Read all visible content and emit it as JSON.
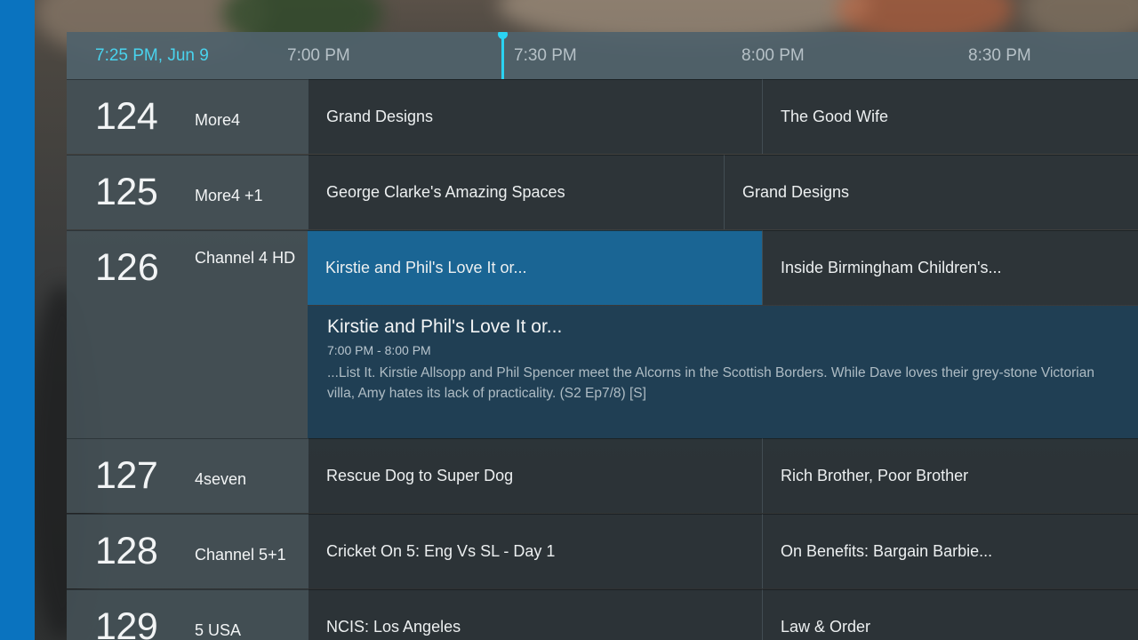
{
  "timebar": {
    "current": "7:25 PM, Jun 9",
    "slots": [
      "7:00 PM",
      "7:30 PM",
      "8:00 PM",
      "8:30 PM"
    ]
  },
  "channels": [
    {
      "number": "124",
      "name": "More4",
      "programs": [
        {
          "title": "Grand Designs"
        },
        {
          "title": "The Good Wife"
        }
      ]
    },
    {
      "number": "125",
      "name": "More4 +1",
      "programs": [
        {
          "title": "George Clarke's Amazing Spaces"
        },
        {
          "title": "Grand Designs"
        }
      ]
    },
    {
      "number": "126",
      "name": "Channel 4 HD",
      "programs": [
        {
          "title": "Kirstie and Phil's Love It or..."
        },
        {
          "title": "Inside Birmingham Children's..."
        }
      ]
    },
    {
      "number": "127",
      "name": "4seven",
      "programs": [
        {
          "title": "Rescue Dog to Super Dog"
        },
        {
          "title": "Rich Brother, Poor Brother"
        }
      ]
    },
    {
      "number": "128",
      "name": "Channel 5+1",
      "programs": [
        {
          "title": "Cricket On 5: Eng Vs SL - Day 1"
        },
        {
          "title": "On Benefits: Bargain Barbie..."
        }
      ]
    },
    {
      "number": "129",
      "name": "5 USA",
      "programs": [
        {
          "title": "NCIS: Los Angeles"
        },
        {
          "title": "Law & Order"
        }
      ]
    }
  ],
  "detail": {
    "title": "Kirstie and Phil's Love It or...",
    "time": "7:00 PM - 8:00 PM",
    "description": "...List It. Kirstie Allsopp and Phil Spencer meet the Alcorns in the Scottish Borders. While Dave loves their grey-stone Victorian villa, Amy hates its lack of practicality. (S2 Ep7/8)  [S]"
  },
  "colors": {
    "accent": "#2bd3f2",
    "selected": "#1a6594",
    "side_strip": "#0a73bf"
  }
}
